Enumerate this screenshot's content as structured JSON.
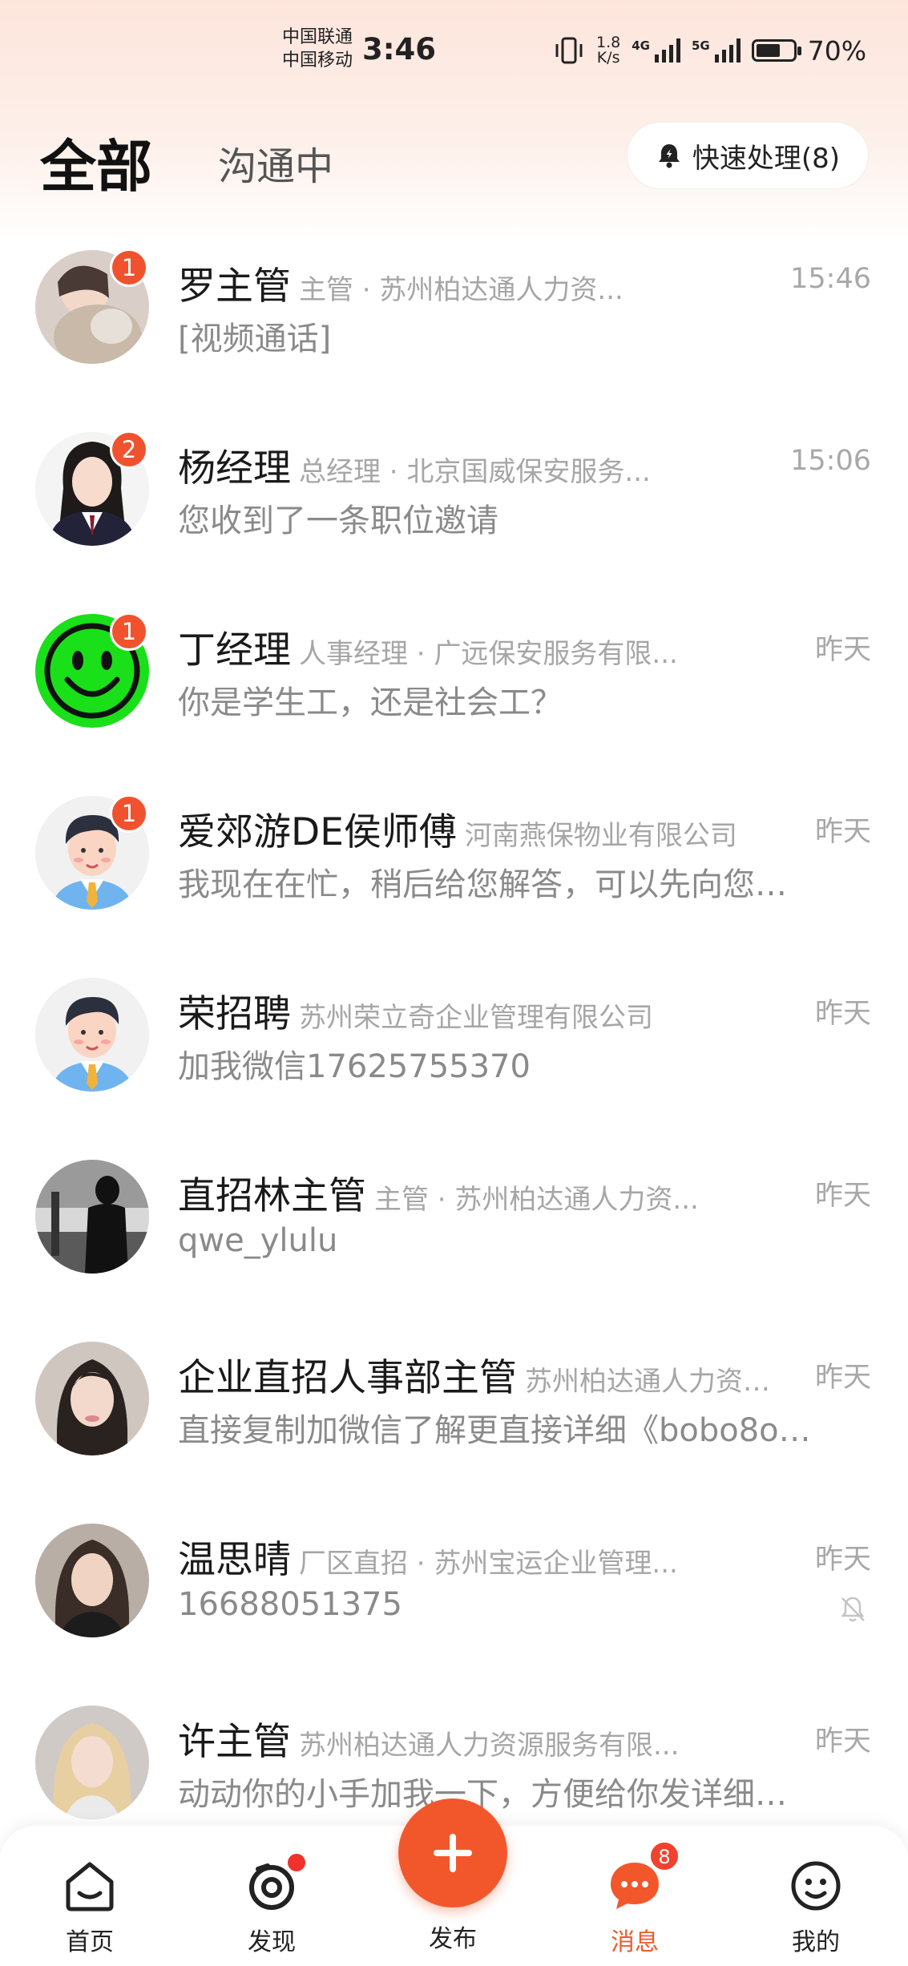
{
  "status_bar": {
    "carrier_1": "中国联通",
    "carrier_2": "中国移动",
    "time": "3:46",
    "net_speed_value": "1.8",
    "net_speed_unit": "K/s",
    "signal_1_label": "4G",
    "signal_2_label": "5G",
    "battery_percent": "70%"
  },
  "header": {
    "tab_all": "全部",
    "tab_chatting": "沟通中",
    "quick_process_label": "快速处理(8)"
  },
  "conversations": [
    {
      "name": "罗主管",
      "subtitle": "主管 · 苏州柏达通人力资...",
      "time": "15:46",
      "message": "[视频通话]",
      "badge": "1",
      "avatar": "photo-girl-cat-avatar"
    },
    {
      "name": "杨经理",
      "subtitle": "总经理 · 北京国威保安服务...",
      "time": "15:06",
      "message": "您收到了一条职位邀请",
      "badge": "2",
      "avatar": "photo-woman-suit-avatar"
    },
    {
      "name": "丁经理",
      "subtitle": "人事经理 · 广远保安服务有限...",
      "time": "昨天",
      "message": "你是学生工，还是社会工？",
      "badge": "1",
      "avatar": "smiley-face-avatar"
    },
    {
      "name": "爱郊游DE侯师傅",
      "subtitle": "河南燕保物业有限公司",
      "time": "昨天",
      "message": "我现在在忙，稍后给您解答，可以先向您…",
      "badge": "1",
      "avatar": "cartoon-man-avatar"
    },
    {
      "name": "荣招聘",
      "subtitle": "苏州荣立奇企业管理有限公司",
      "time": "昨天",
      "message": "加我微信17625755370",
      "badge": "",
      "avatar": "cartoon-man-avatar"
    },
    {
      "name": "直招林主管",
      "subtitle": "主管 · 苏州柏达通人力资...",
      "time": "昨天",
      "message": "qwe_ylulu",
      "badge": "",
      "avatar": "photo-bw-man-avatar"
    },
    {
      "name": "企业直招人事部主管",
      "subtitle": "苏州柏达通人力资…",
      "time": "昨天",
      "message": "直接复制加微信了解更直接详细《bobo8o…",
      "badge": "",
      "avatar": "photo-woman-avatar"
    },
    {
      "name": "温思晴",
      "subtitle": "厂区直招 · 苏州宝运企业管理...",
      "time": "昨天",
      "message": "16688051375",
      "badge": "",
      "avatar": "photo-woman-dark-avatar",
      "muted": true
    },
    {
      "name": "许主管",
      "subtitle": "苏州柏达通人力资源服务有限...",
      "time": "昨天",
      "message": "动动你的小手加我一下，方便给你发详细…",
      "badge": "",
      "avatar": "photo-blonde-woman-avatar"
    }
  ],
  "bottom_nav": {
    "home": "首页",
    "discover": "发现",
    "publish": "发布",
    "messages": "消息",
    "messages_badge": "8",
    "mine": "我的"
  },
  "colors": {
    "accent": "#f2572c",
    "badge": "#f0522e",
    "header_gradient_top": "#fde5dc"
  }
}
